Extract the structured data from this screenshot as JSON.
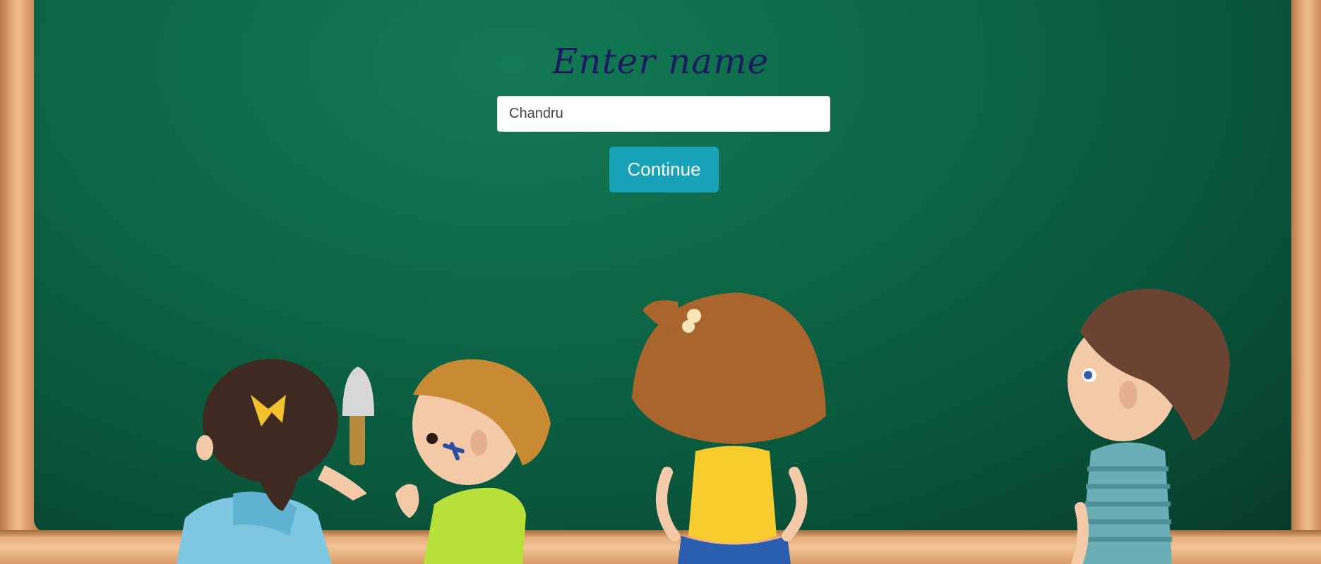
{
  "page": {
    "title": "Enter name"
  },
  "form": {
    "name_value": "Chandru",
    "continue_label": "Continue"
  },
  "colors": {
    "board": "#0d6848",
    "frame": "#e3a877",
    "title": "#1b1d5e",
    "button": "#17a2b8"
  },
  "illustration": {
    "kids": [
      "girl-with-paintbrush",
      "boy-with-paint-on-face",
      "girl-with-short-hair",
      "boy-in-striped-shirt"
    ]
  }
}
